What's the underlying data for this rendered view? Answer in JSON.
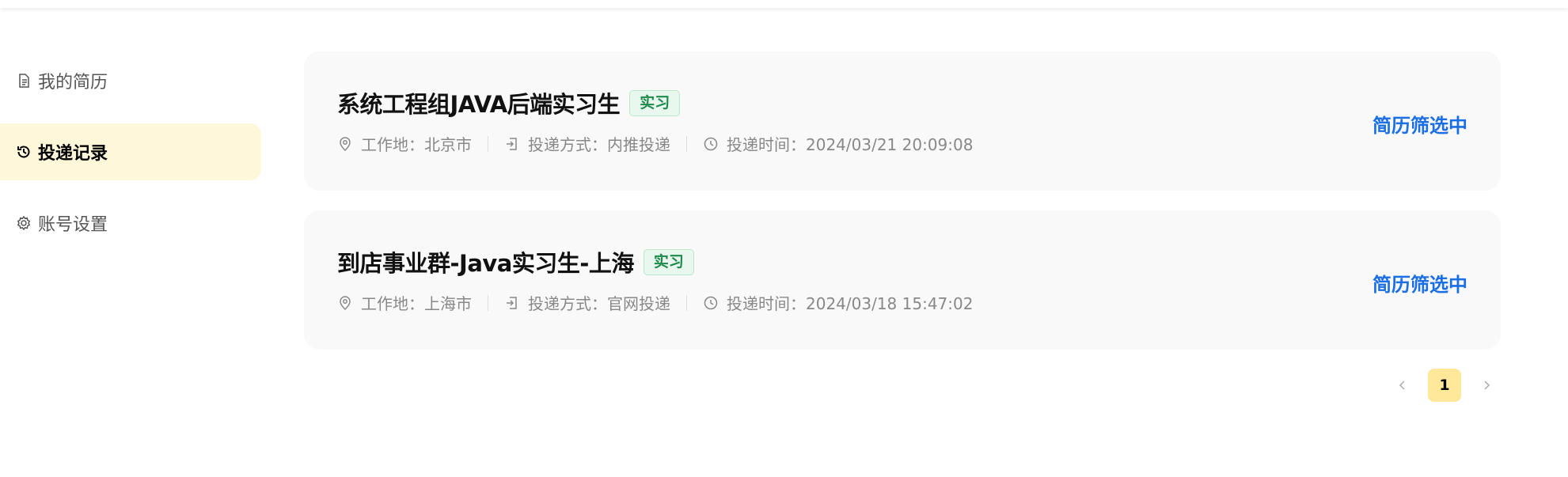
{
  "sidebar": {
    "items": [
      {
        "label": "我的简历",
        "icon": "document-icon",
        "active": false
      },
      {
        "label": "投递记录",
        "icon": "history-icon",
        "active": true
      },
      {
        "label": "账号设置",
        "icon": "gear-icon",
        "active": false
      }
    ]
  },
  "applications": [
    {
      "title": "系统工程组JAVA后端实习生",
      "tag": "实习",
      "location": "工作地：北京市",
      "method": "投递方式：内推投递",
      "time": "投递时间：2024/03/21 20:09:08",
      "status": "简历筛选中"
    },
    {
      "title": "到店事业群-Java实习生-上海",
      "tag": "实习",
      "location": "工作地：上海市",
      "method": "投递方式：官网投递",
      "time": "投递时间：2024/03/18 15:47:02",
      "status": "简历筛选中"
    }
  ],
  "pagination": {
    "prev_icon": "chevron-left-icon",
    "current_page": "1",
    "next_icon": "chevron-right-icon"
  },
  "colors": {
    "active_bg": "#fff7d9",
    "status_blue": "#1a6ee6",
    "tag_green": "#1f8a4c",
    "page_active": "#ffe89a"
  }
}
